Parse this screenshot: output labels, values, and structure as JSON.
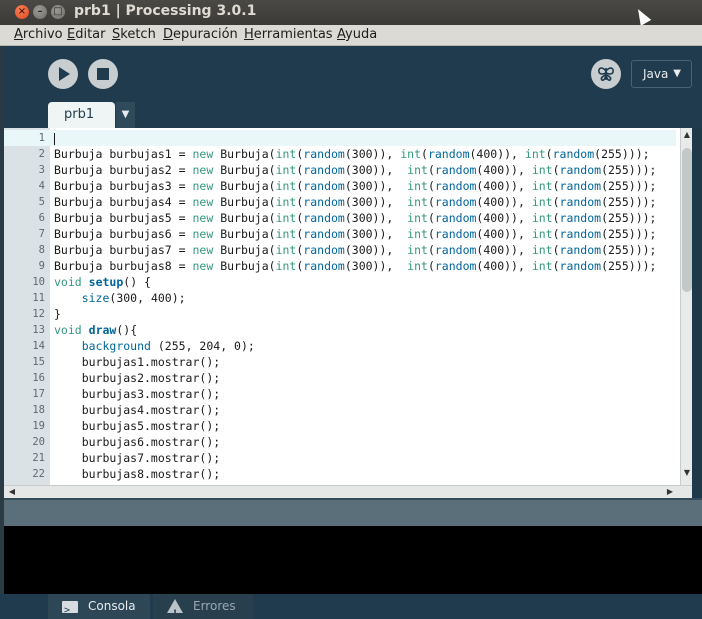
{
  "window": {
    "title": "prb1 | Processing 3.0.1",
    "close_glyph": "×",
    "min_glyph": "–",
    "max_glyph": "□"
  },
  "menu": [
    {
      "underline": "A",
      "rest": "rchivo"
    },
    {
      "underline": "E",
      "rest": "ditar"
    },
    {
      "underline": "S",
      "rest": "ketch"
    },
    {
      "underline": "D",
      "rest": "epuración"
    },
    {
      "underline": "H",
      "rest": "erramientas"
    },
    {
      "underline": "A",
      "rest": "yuda"
    }
  ],
  "toolbar": {
    "run_icon": "play-icon",
    "stop_icon": "stop-icon",
    "debug_icon": "butterfly-icon",
    "mode": "Java",
    "mode_caret": "▼"
  },
  "tabs": {
    "active": "prb1",
    "menu_caret": "▼"
  },
  "editor": {
    "lines": [
      {
        "n": "1",
        "tokens": []
      },
      {
        "n": "2",
        "tokens": [
          [
            "",
            "Burbuja burbujas1 = "
          ],
          [
            "kw",
            "new"
          ],
          [
            "",
            " Burbuja("
          ],
          [
            "kw",
            "int"
          ],
          [
            "",
            "("
          ],
          [
            "fn",
            "random"
          ],
          [
            "",
            "(300)), "
          ],
          [
            "kw",
            "int"
          ],
          [
            "",
            "("
          ],
          [
            "fn",
            "random"
          ],
          [
            "",
            "(400)), "
          ],
          [
            "kw",
            "int"
          ],
          [
            "",
            "("
          ],
          [
            "fn",
            "random"
          ],
          [
            "",
            "(255)));"
          ]
        ]
      },
      {
        "n": "3",
        "tokens": [
          [
            "",
            "Burbuja burbujas2 = "
          ],
          [
            "kw",
            "new"
          ],
          [
            "",
            " Burbuja("
          ],
          [
            "kw",
            "int"
          ],
          [
            "",
            "("
          ],
          [
            "fn",
            "random"
          ],
          [
            "",
            "(300)),  "
          ],
          [
            "kw",
            "int"
          ],
          [
            "",
            "("
          ],
          [
            "fn",
            "random"
          ],
          [
            "",
            "(400)), "
          ],
          [
            "kw",
            "int"
          ],
          [
            "",
            "("
          ],
          [
            "fn",
            "random"
          ],
          [
            "",
            "(255)));"
          ]
        ]
      },
      {
        "n": "4",
        "tokens": [
          [
            "",
            "Burbuja burbujas3 = "
          ],
          [
            "kw",
            "new"
          ],
          [
            "",
            " Burbuja("
          ],
          [
            "kw",
            "int"
          ],
          [
            "",
            "("
          ],
          [
            "fn",
            "random"
          ],
          [
            "",
            "(300)),  "
          ],
          [
            "kw",
            "int"
          ],
          [
            "",
            "("
          ],
          [
            "fn",
            "random"
          ],
          [
            "",
            "(400)), "
          ],
          [
            "kw",
            "int"
          ],
          [
            "",
            "("
          ],
          [
            "fn",
            "random"
          ],
          [
            "",
            "(255)));"
          ]
        ]
      },
      {
        "n": "5",
        "tokens": [
          [
            "",
            "Burbuja burbujas4 = "
          ],
          [
            "kw",
            "new"
          ],
          [
            "",
            " Burbuja("
          ],
          [
            "kw",
            "int"
          ],
          [
            "",
            "("
          ],
          [
            "fn",
            "random"
          ],
          [
            "",
            "(300)),  "
          ],
          [
            "kw",
            "int"
          ],
          [
            "",
            "("
          ],
          [
            "fn",
            "random"
          ],
          [
            "",
            "(400)), "
          ],
          [
            "kw",
            "int"
          ],
          [
            "",
            "("
          ],
          [
            "fn",
            "random"
          ],
          [
            "",
            "(255)));"
          ]
        ]
      },
      {
        "n": "6",
        "tokens": [
          [
            "",
            "Burbuja burbujas5 = "
          ],
          [
            "kw",
            "new"
          ],
          [
            "",
            " Burbuja("
          ],
          [
            "kw",
            "int"
          ],
          [
            "",
            "("
          ],
          [
            "fn",
            "random"
          ],
          [
            "",
            "(300)),  "
          ],
          [
            "kw",
            "int"
          ],
          [
            "",
            "("
          ],
          [
            "fn",
            "random"
          ],
          [
            "",
            "(400)), "
          ],
          [
            "kw",
            "int"
          ],
          [
            "",
            "("
          ],
          [
            "fn",
            "random"
          ],
          [
            "",
            "(255)));"
          ]
        ]
      },
      {
        "n": "7",
        "tokens": [
          [
            "",
            "Burbuja burbujas6 = "
          ],
          [
            "kw",
            "new"
          ],
          [
            "",
            " Burbuja("
          ],
          [
            "kw",
            "int"
          ],
          [
            "",
            "("
          ],
          [
            "fn",
            "random"
          ],
          [
            "",
            "(300)),  "
          ],
          [
            "kw",
            "int"
          ],
          [
            "",
            "("
          ],
          [
            "fn",
            "random"
          ],
          [
            "",
            "(400)), "
          ],
          [
            "kw",
            "int"
          ],
          [
            "",
            "("
          ],
          [
            "fn",
            "random"
          ],
          [
            "",
            "(255)));"
          ]
        ]
      },
      {
        "n": "8",
        "tokens": [
          [
            "",
            "Burbuja burbujas7 = "
          ],
          [
            "kw",
            "new"
          ],
          [
            "",
            " Burbuja("
          ],
          [
            "kw",
            "int"
          ],
          [
            "",
            "("
          ],
          [
            "fn",
            "random"
          ],
          [
            "",
            "(300)),  "
          ],
          [
            "kw",
            "int"
          ],
          [
            "",
            "("
          ],
          [
            "fn",
            "random"
          ],
          [
            "",
            "(400)), "
          ],
          [
            "kw",
            "int"
          ],
          [
            "",
            "("
          ],
          [
            "fn",
            "random"
          ],
          [
            "",
            "(255)));"
          ]
        ]
      },
      {
        "n": "9",
        "tokens": [
          [
            "",
            "Burbuja burbujas8 = "
          ],
          [
            "kw",
            "new"
          ],
          [
            "",
            " Burbuja("
          ],
          [
            "kw",
            "int"
          ],
          [
            "",
            "("
          ],
          [
            "fn",
            "random"
          ],
          [
            "",
            "(300)),  "
          ],
          [
            "kw",
            "int"
          ],
          [
            "",
            "("
          ],
          [
            "fn",
            "random"
          ],
          [
            "",
            "(400)), "
          ],
          [
            "kw",
            "int"
          ],
          [
            "",
            "("
          ],
          [
            "fn",
            "random"
          ],
          [
            "",
            "(255)));"
          ]
        ]
      },
      {
        "n": "10",
        "tokens": [
          [
            "kw",
            "void"
          ],
          [
            "",
            " "
          ],
          [
            "fnb",
            "setup"
          ],
          [
            "",
            "() {"
          ]
        ]
      },
      {
        "n": "11",
        "tokens": [
          [
            "",
            "    "
          ],
          [
            "fn",
            "size"
          ],
          [
            "",
            "(300, 400);"
          ]
        ]
      },
      {
        "n": "12",
        "tokens": [
          [
            "",
            "}"
          ]
        ]
      },
      {
        "n": "13",
        "tokens": [
          [
            "kw",
            "void"
          ],
          [
            "",
            " "
          ],
          [
            "fnb",
            "draw"
          ],
          [
            "",
            "(){"
          ]
        ]
      },
      {
        "n": "14",
        "tokens": [
          [
            "",
            "    "
          ],
          [
            "fn",
            "background"
          ],
          [
            "",
            " (255, 204, 0);"
          ]
        ]
      },
      {
        "n": "15",
        "tokens": [
          [
            "",
            "    burbujas1.mostrar();"
          ]
        ]
      },
      {
        "n": "16",
        "tokens": [
          [
            "",
            "    burbujas2.mostrar();"
          ]
        ]
      },
      {
        "n": "17",
        "tokens": [
          [
            "",
            "    burbujas3.mostrar();"
          ]
        ]
      },
      {
        "n": "18",
        "tokens": [
          [
            "",
            "    burbujas4.mostrar();"
          ]
        ]
      },
      {
        "n": "19",
        "tokens": [
          [
            "",
            "    burbujas5.mostrar();"
          ]
        ]
      },
      {
        "n": "20",
        "tokens": [
          [
            "",
            "    burbujas6.mostrar();"
          ]
        ]
      },
      {
        "n": "21",
        "tokens": [
          [
            "",
            "    burbujas7.mostrar();"
          ]
        ]
      },
      {
        "n": "22",
        "tokens": [
          [
            "",
            "    burbujas8.mostrar();"
          ]
        ]
      }
    ]
  },
  "scroll": {
    "up": "▲",
    "down": "▼",
    "left": "◀",
    "right": "▶"
  },
  "bottom_tabs": {
    "console": "Consola",
    "console_icon_glyph": ">_",
    "errors": "Errores",
    "errors_icon_glyph": "!"
  },
  "colors": {
    "accent": "#1f3b4d",
    "keyword": "#33997e",
    "function": "#006699"
  }
}
